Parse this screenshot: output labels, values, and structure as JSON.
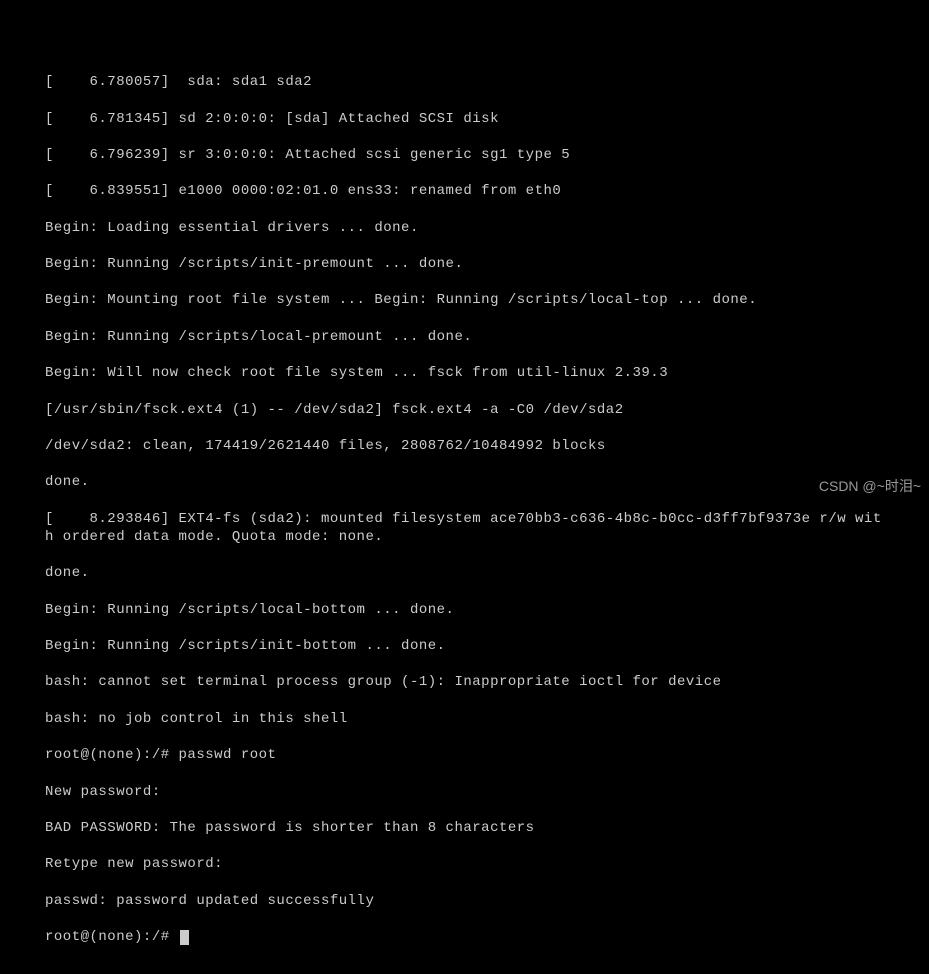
{
  "terminal": {
    "lines": [
      "[    6.780057]  sda: sda1 sda2",
      "[    6.781345] sd 2:0:0:0: [sda] Attached SCSI disk",
      "[    6.796239] sr 3:0:0:0: Attached scsi generic sg1 type 5",
      "[    6.839551] e1000 0000:02:01.0 ens33: renamed from eth0",
      "Begin: Loading essential drivers ... done.",
      "Begin: Running /scripts/init-premount ... done.",
      "Begin: Mounting root file system ... Begin: Running /scripts/local-top ... done.",
      "Begin: Running /scripts/local-premount ... done.",
      "Begin: Will now check root file system ... fsck from util-linux 2.39.3",
      "[/usr/sbin/fsck.ext4 (1) -- /dev/sda2] fsck.ext4 -a -C0 /dev/sda2",
      "/dev/sda2: clean, 174419/2621440 files, 2808762/10484992 blocks",
      "done.",
      "[    8.293846] EXT4-fs (sda2): mounted filesystem ace70bb3-c636-4b8c-b0cc-d3ff7bf9373e r/w with ordered data mode. Quota mode: none.",
      "done.",
      "Begin: Running /scripts/local-bottom ... done.",
      "Begin: Running /scripts/init-bottom ... done.",
      "bash: cannot set terminal process group (-1): Inappropriate ioctl for device",
      "bash: no job control in this shell",
      "root@(none):/# passwd root",
      "New password:",
      "BAD PASSWORD: The password is shorter than 8 characters",
      "Retype new password:",
      "passwd: password updated successfully"
    ],
    "prompt": "root@(none):/# "
  },
  "watermark": "CSDN @~时泪~"
}
